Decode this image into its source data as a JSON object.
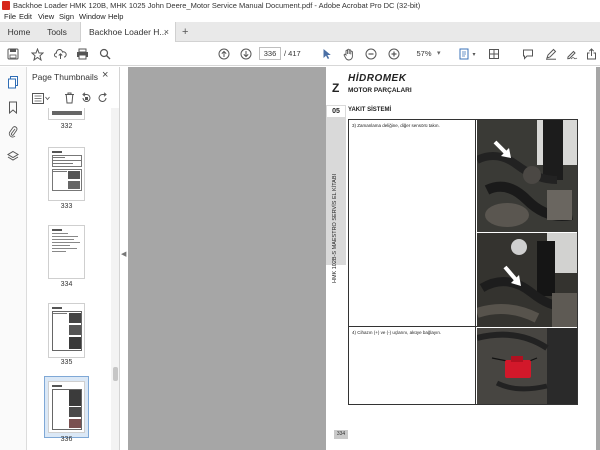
{
  "window": {
    "title": "Backhoe Loader HMK 120B, MHK 1025 John Deere_Motor Service Manual Document.pdf - Adobe Acrobat Pro DC (32-bit)"
  },
  "menu": [
    "File",
    "Edit",
    "View",
    "Sign",
    "Window",
    "Help"
  ],
  "tabs": {
    "home": "Home",
    "tools": "Tools",
    "document": "Backhoe Loader H...",
    "close_glyph": "×",
    "add_glyph": "+"
  },
  "toolbar": {
    "current_page": "336",
    "page_total": "/ 417",
    "zoom": "57%"
  },
  "thumbnails_panel": {
    "title": "Page Thumbnails",
    "close_glyph": "×",
    "thumbnails": [
      {
        "label": "332",
        "selected": false
      },
      {
        "label": "333",
        "selected": false
      },
      {
        "label": "334",
        "selected": false
      },
      {
        "label": "335",
        "selected": false
      },
      {
        "label": "336",
        "selected": true
      }
    ]
  },
  "document_page": {
    "brand": "HİDROMEK",
    "chapter_letter": "Z",
    "section_title": "MOTOR PARÇALARI",
    "section_number": "05",
    "subsection_title": "YAKIT SİSTEMİ",
    "side_text": "HMK 102B-S MAESTRO SERVİS EL KİTABI",
    "steps": [
      "3) Zamanlama deliğine, diğer sensörü takın.",
      "4) Cihazın (+) ve (-) uçlarını, aküye bağlayın."
    ],
    "page_number": "334"
  },
  "colors": {
    "acrobat_red": "#d7271c",
    "selection_blue": "#dbe8f6",
    "canvas_grey": "#a6a6a6"
  }
}
